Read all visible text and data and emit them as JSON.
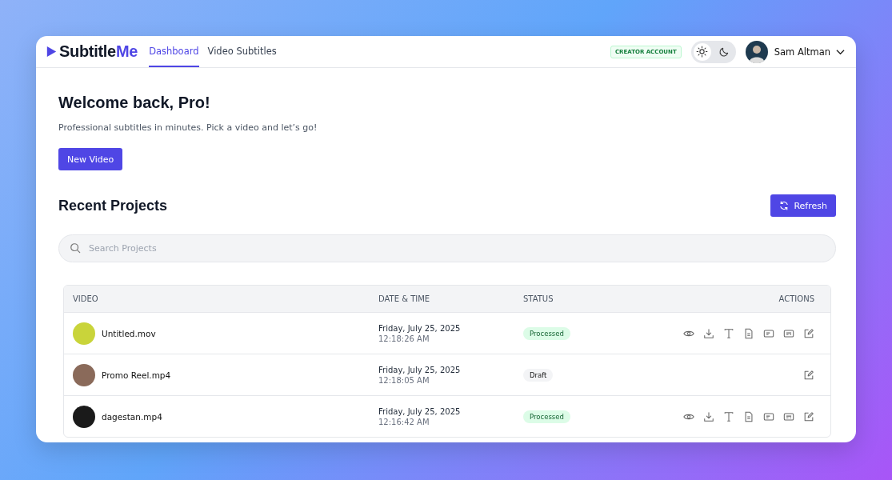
{
  "logo": {
    "parts": [
      {
        "text": "Subtitle",
        "accent": false
      },
      {
        "text": "Me",
        "accent": true
      }
    ]
  },
  "nav": [
    {
      "label": "Dashboard",
      "selected": true
    },
    {
      "label": "Video Subtitles",
      "selected": false
    }
  ],
  "account_badge": "CREATOR ACCOUNT",
  "theme_toggle": [
    {
      "kind": "light",
      "selected": true
    },
    {
      "kind": "dark",
      "selected": false
    }
  ],
  "user": {
    "name": "Sam Altman"
  },
  "welcome": {
    "title": "Welcome back, Pro!",
    "subtitle": "Professional subtitles in minutes. Pick a video and let’s go!",
    "button": "New Video"
  },
  "projects": {
    "title": "Recent Projects",
    "refresh_button": "Refresh",
    "search": {
      "placeholder": "Search Projects"
    },
    "columns": [
      "VIDEO",
      "DATE & TIME",
      "STATUS",
      "ACTIONS"
    ],
    "rows": [
      {
        "name": "Untitled.mov",
        "date": "Friday, July 25, 2025",
        "time": "12:18:26 AM",
        "status": {
          "label": "Processed",
          "kind": "processed"
        },
        "actions": [
          {
            "kind": "view"
          },
          {
            "kind": "download"
          },
          {
            "kind": "text"
          },
          {
            "kind": "document"
          },
          {
            "kind": "caption"
          },
          {
            "kind": "subtitle"
          },
          {
            "kind": "edit"
          }
        ]
      },
      {
        "name": "Promo Reel.mp4",
        "date": "Friday, July 25, 2025",
        "time": "12:18:05 AM",
        "status": {
          "label": "Draft",
          "kind": "draft"
        },
        "actions": [
          {
            "kind": "edit"
          }
        ]
      },
      {
        "name": "dagestan.mp4",
        "date": "Friday, July 25, 2025",
        "time": "12:16:42 AM",
        "status": {
          "label": "Processed",
          "kind": "processed"
        },
        "actions": [
          {
            "kind": "view"
          },
          {
            "kind": "download"
          },
          {
            "kind": "text"
          },
          {
            "kind": "document"
          },
          {
            "kind": "caption"
          },
          {
            "kind": "subtitle"
          },
          {
            "kind": "edit"
          }
        ]
      }
    ]
  }
}
